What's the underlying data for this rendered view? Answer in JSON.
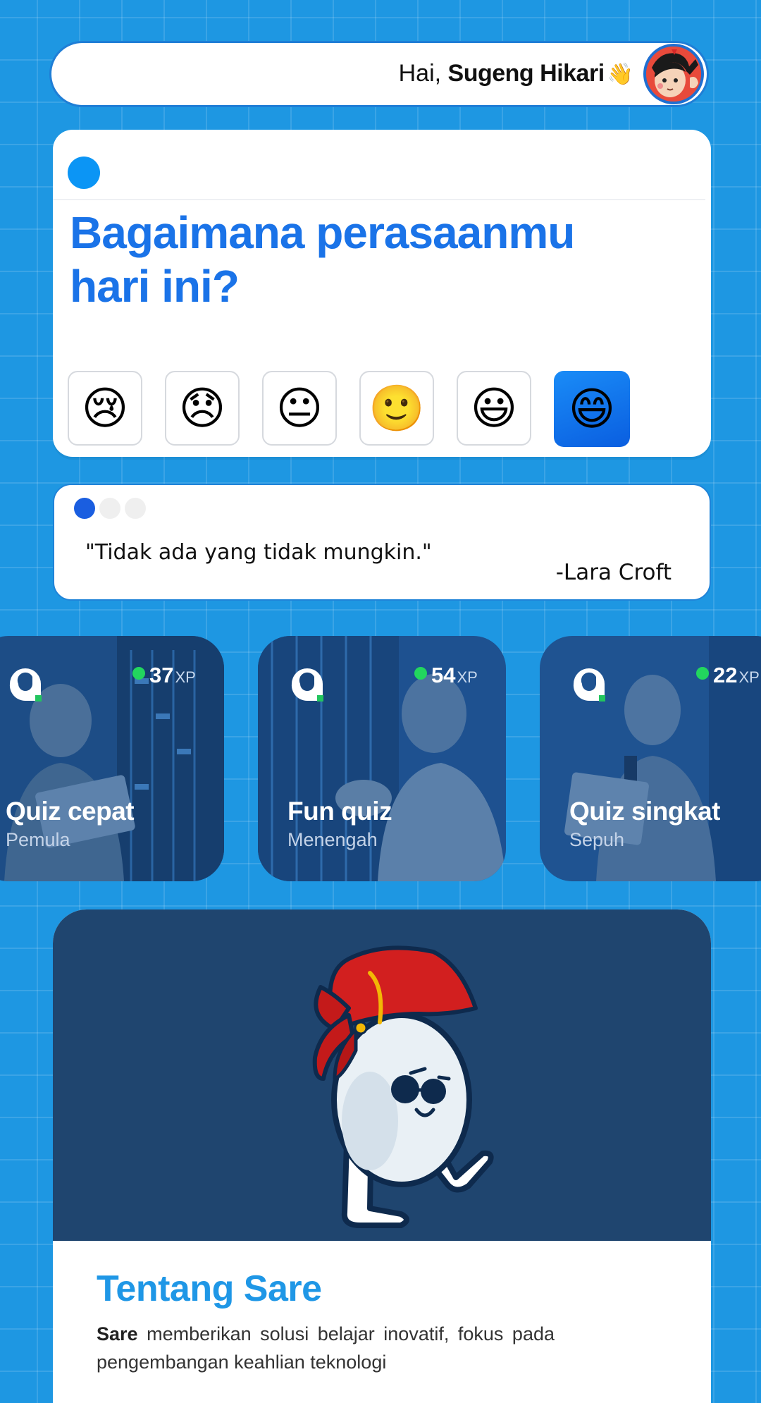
{
  "header": {
    "greeting_prefix": "Hai, ",
    "user_name": "Sugeng Hikari",
    "wave_emoji": "👋"
  },
  "mood": {
    "title": "Bagaimana perasaanmu hari ini?",
    "options": [
      "😢",
      "😞",
      "😐",
      "🙂",
      "😃",
      "😄"
    ],
    "selected_index": 5
  },
  "quote": {
    "text": "\"Tidak ada yang tidak mungkin.\"",
    "author": "-Lara Croft",
    "active_dot": 0,
    "dot_count": 3
  },
  "quizzes": [
    {
      "title": "Quiz cepat",
      "level": "Pemula",
      "xp": "37",
      "xp_unit": "XP"
    },
    {
      "title": "Fun quiz",
      "level": "Menengah",
      "xp": "54",
      "xp_unit": "XP"
    },
    {
      "title": "Quiz singkat",
      "level": "Sepuh",
      "xp": "22",
      "xp_unit": "XP"
    }
  ],
  "about": {
    "title": "Tentang Sare",
    "brand": "Sare",
    "text": " memberikan solusi belajar inovatif, fokus pada pengembangan keahlian teknologi"
  },
  "colors": {
    "background": "#1e97e2",
    "primary_blue": "#1a73e8",
    "card_dark": "#1f456f",
    "xp_green": "#22d65e"
  }
}
